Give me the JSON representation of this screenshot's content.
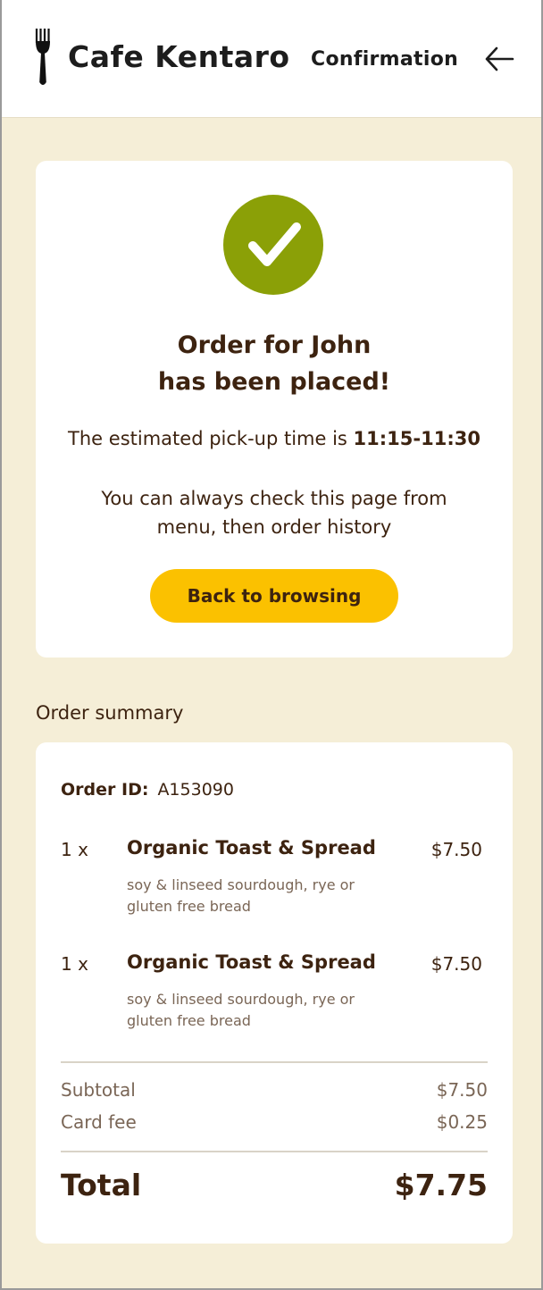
{
  "header": {
    "brand": "Cafe Kentaro",
    "title": "Confirmation",
    "logo_icon": "fork-icon",
    "back_icon": "arrow-left-icon"
  },
  "confirmation": {
    "line1": "Order for John",
    "line2": "has been placed!",
    "pickup_prefix": "The estimated pick-up time is ",
    "pickup_time": "11:15-11:30",
    "note_line1": "You can always check this page from",
    "note_line2": "menu, then order history",
    "button_label": "Back to browsing",
    "status_icon": "check-circle-icon"
  },
  "summary": {
    "label": "Order summary",
    "order_id_label": "Order ID:",
    "order_id": "A153090",
    "items": [
      {
        "qty": "1 x",
        "name": "Organic Toast & Spread",
        "price": "$7.50",
        "desc_line1": "soy & linseed sourdough, rye or",
        "desc_line2": "gluten free bread"
      },
      {
        "qty": "1 x",
        "name": "Organic Toast & Spread",
        "price": "$7.50",
        "desc_line1": "soy & linseed sourdough, rye or",
        "desc_line2": "gluten free bread"
      }
    ],
    "subtotal_label": "Subtotal",
    "subtotal": "$7.50",
    "fee_label": "Card fee",
    "fee": "$0.25",
    "total_label": "Total",
    "total": "$7.75"
  },
  "colors": {
    "background": "#f5eed7",
    "text": "#3d2310",
    "accent_green": "#8ba007",
    "button_yellow": "#fbc100"
  }
}
